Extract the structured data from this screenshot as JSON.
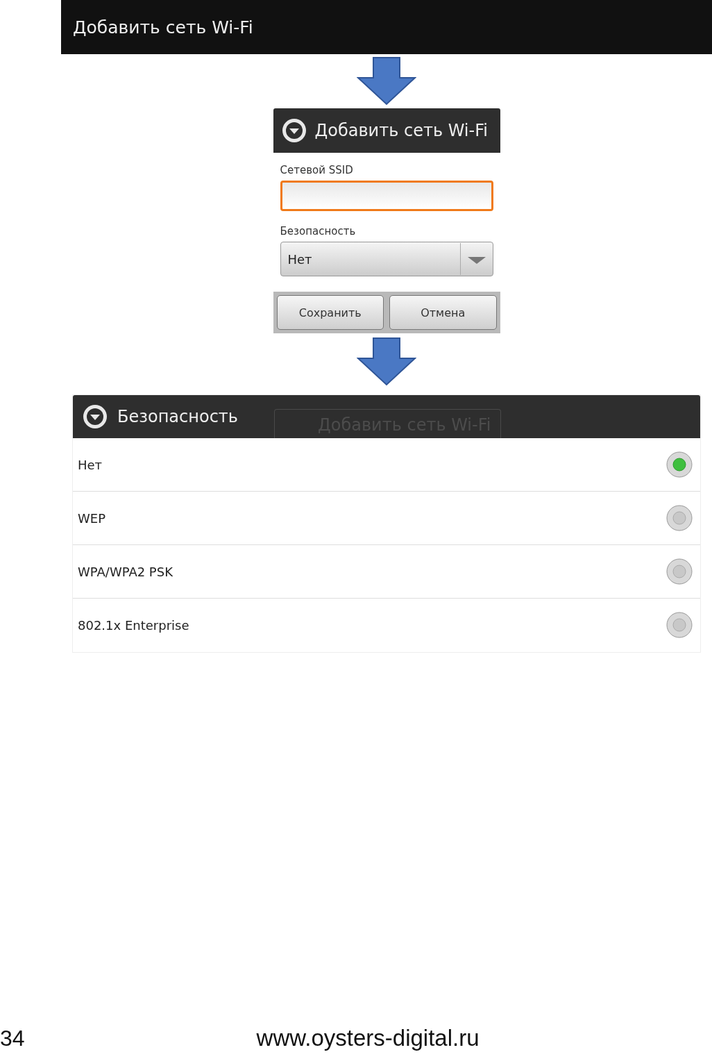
{
  "top_bar": {
    "title": "Добавить сеть Wi-Fi"
  },
  "dialog": {
    "title": "Добавить сеть Wi-Fi",
    "ssid_label": "Сетевой SSID",
    "ssid": {
      "focused": true
    },
    "security_label": "Безопасность",
    "security_value": "Нет",
    "buttons": [
      "Сохранить",
      "Отмена"
    ]
  },
  "security_list": {
    "title": "Безопасность",
    "ghost_title": "Добавить сеть Wi-Fi",
    "options": [
      {
        "label": "Нет",
        "selected": true
      },
      {
        "label": "WEP",
        "selected": false
      },
      {
        "label": "WPA/WPA2 PSK",
        "selected": false
      },
      {
        "label": "802.1x Enterprise",
        "selected": false
      }
    ]
  },
  "footer": {
    "page_number": "34",
    "url": "www.oysters-digital.ru"
  }
}
